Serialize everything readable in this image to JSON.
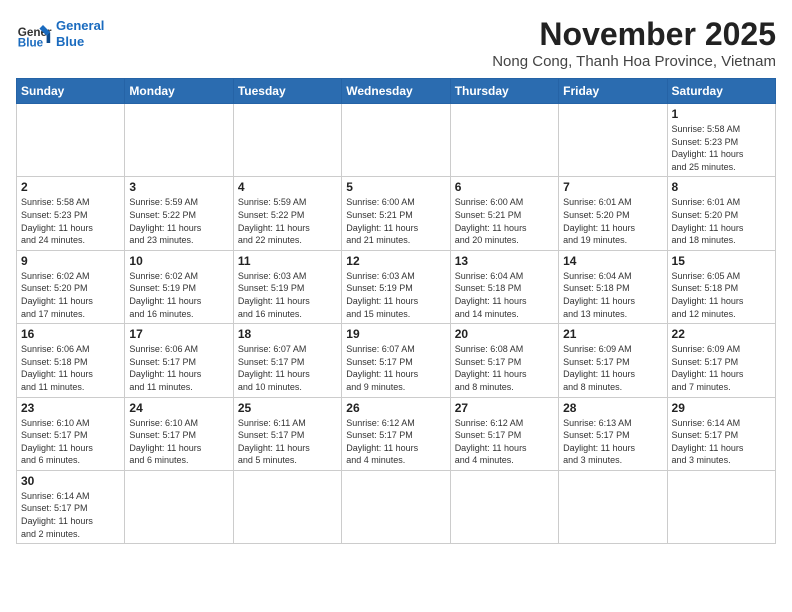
{
  "header": {
    "logo_line1": "General",
    "logo_line2": "Blue",
    "month_title": "November 2025",
    "subtitle": "Nong Cong, Thanh Hoa Province, Vietnam"
  },
  "weekdays": [
    "Sunday",
    "Monday",
    "Tuesday",
    "Wednesday",
    "Thursday",
    "Friday",
    "Saturday"
  ],
  "weeks": [
    [
      {
        "day": "",
        "info": ""
      },
      {
        "day": "",
        "info": ""
      },
      {
        "day": "",
        "info": ""
      },
      {
        "day": "",
        "info": ""
      },
      {
        "day": "",
        "info": ""
      },
      {
        "day": "",
        "info": ""
      },
      {
        "day": "1",
        "info": "Sunrise: 5:58 AM\nSunset: 5:23 PM\nDaylight: 11 hours\nand 25 minutes."
      }
    ],
    [
      {
        "day": "2",
        "info": "Sunrise: 5:58 AM\nSunset: 5:23 PM\nDaylight: 11 hours\nand 24 minutes."
      },
      {
        "day": "3",
        "info": "Sunrise: 5:59 AM\nSunset: 5:22 PM\nDaylight: 11 hours\nand 23 minutes."
      },
      {
        "day": "4",
        "info": "Sunrise: 5:59 AM\nSunset: 5:22 PM\nDaylight: 11 hours\nand 22 minutes."
      },
      {
        "day": "5",
        "info": "Sunrise: 6:00 AM\nSunset: 5:21 PM\nDaylight: 11 hours\nand 21 minutes."
      },
      {
        "day": "6",
        "info": "Sunrise: 6:00 AM\nSunset: 5:21 PM\nDaylight: 11 hours\nand 20 minutes."
      },
      {
        "day": "7",
        "info": "Sunrise: 6:01 AM\nSunset: 5:20 PM\nDaylight: 11 hours\nand 19 minutes."
      },
      {
        "day": "8",
        "info": "Sunrise: 6:01 AM\nSunset: 5:20 PM\nDaylight: 11 hours\nand 18 minutes."
      }
    ],
    [
      {
        "day": "9",
        "info": "Sunrise: 6:02 AM\nSunset: 5:20 PM\nDaylight: 11 hours\nand 17 minutes."
      },
      {
        "day": "10",
        "info": "Sunrise: 6:02 AM\nSunset: 5:19 PM\nDaylight: 11 hours\nand 16 minutes."
      },
      {
        "day": "11",
        "info": "Sunrise: 6:03 AM\nSunset: 5:19 PM\nDaylight: 11 hours\nand 16 minutes."
      },
      {
        "day": "12",
        "info": "Sunrise: 6:03 AM\nSunset: 5:19 PM\nDaylight: 11 hours\nand 15 minutes."
      },
      {
        "day": "13",
        "info": "Sunrise: 6:04 AM\nSunset: 5:18 PM\nDaylight: 11 hours\nand 14 minutes."
      },
      {
        "day": "14",
        "info": "Sunrise: 6:04 AM\nSunset: 5:18 PM\nDaylight: 11 hours\nand 13 minutes."
      },
      {
        "day": "15",
        "info": "Sunrise: 6:05 AM\nSunset: 5:18 PM\nDaylight: 11 hours\nand 12 minutes."
      }
    ],
    [
      {
        "day": "16",
        "info": "Sunrise: 6:06 AM\nSunset: 5:18 PM\nDaylight: 11 hours\nand 11 minutes."
      },
      {
        "day": "17",
        "info": "Sunrise: 6:06 AM\nSunset: 5:17 PM\nDaylight: 11 hours\nand 11 minutes."
      },
      {
        "day": "18",
        "info": "Sunrise: 6:07 AM\nSunset: 5:17 PM\nDaylight: 11 hours\nand 10 minutes."
      },
      {
        "day": "19",
        "info": "Sunrise: 6:07 AM\nSunset: 5:17 PM\nDaylight: 11 hours\nand 9 minutes."
      },
      {
        "day": "20",
        "info": "Sunrise: 6:08 AM\nSunset: 5:17 PM\nDaylight: 11 hours\nand 8 minutes."
      },
      {
        "day": "21",
        "info": "Sunrise: 6:09 AM\nSunset: 5:17 PM\nDaylight: 11 hours\nand 8 minutes."
      },
      {
        "day": "22",
        "info": "Sunrise: 6:09 AM\nSunset: 5:17 PM\nDaylight: 11 hours\nand 7 minutes."
      }
    ],
    [
      {
        "day": "23",
        "info": "Sunrise: 6:10 AM\nSunset: 5:17 PM\nDaylight: 11 hours\nand 6 minutes."
      },
      {
        "day": "24",
        "info": "Sunrise: 6:10 AM\nSunset: 5:17 PM\nDaylight: 11 hours\nand 6 minutes."
      },
      {
        "day": "25",
        "info": "Sunrise: 6:11 AM\nSunset: 5:17 PM\nDaylight: 11 hours\nand 5 minutes."
      },
      {
        "day": "26",
        "info": "Sunrise: 6:12 AM\nSunset: 5:17 PM\nDaylight: 11 hours\nand 4 minutes."
      },
      {
        "day": "27",
        "info": "Sunrise: 6:12 AM\nSunset: 5:17 PM\nDaylight: 11 hours\nand 4 minutes."
      },
      {
        "day": "28",
        "info": "Sunrise: 6:13 AM\nSunset: 5:17 PM\nDaylight: 11 hours\nand 3 minutes."
      },
      {
        "day": "29",
        "info": "Sunrise: 6:14 AM\nSunset: 5:17 PM\nDaylight: 11 hours\nand 3 minutes."
      }
    ],
    [
      {
        "day": "30",
        "info": "Sunrise: 6:14 AM\nSunset: 5:17 PM\nDaylight: 11 hours\nand 2 minutes."
      },
      {
        "day": "",
        "info": ""
      },
      {
        "day": "",
        "info": ""
      },
      {
        "day": "",
        "info": ""
      },
      {
        "day": "",
        "info": ""
      },
      {
        "day": "",
        "info": ""
      },
      {
        "day": "",
        "info": ""
      }
    ]
  ]
}
